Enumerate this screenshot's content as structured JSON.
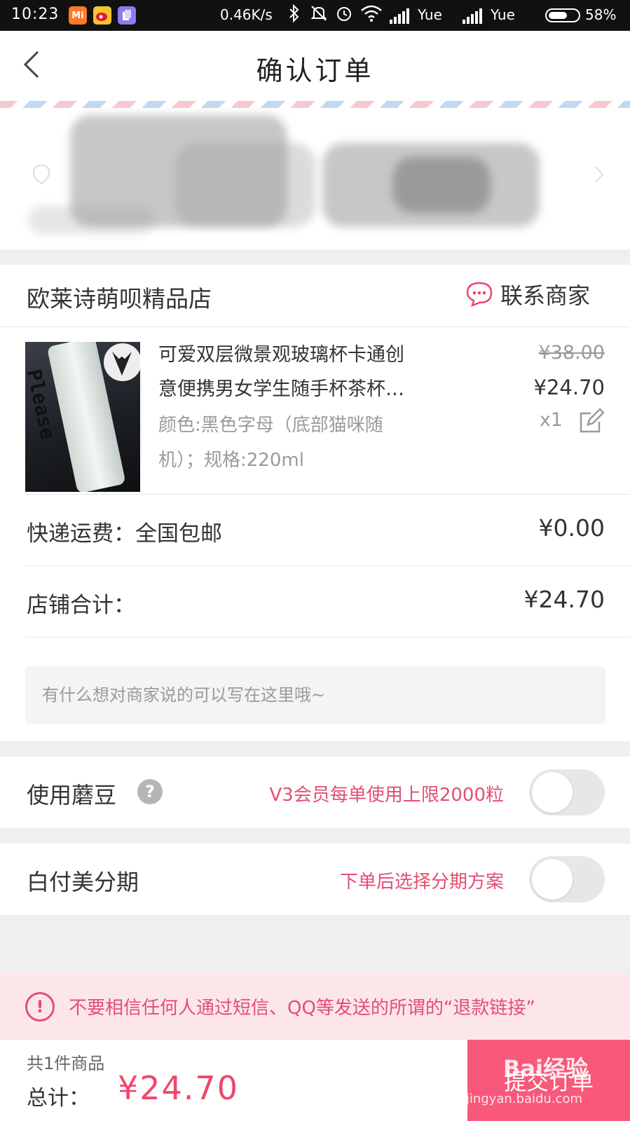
{
  "status_bar": {
    "time": "10:23",
    "net_speed": "0.46K/s",
    "carrier1": "Yue",
    "carrier2": "Yue",
    "battery": "58%",
    "app_icons": [
      "mi-app",
      "weibo",
      "app"
    ]
  },
  "header": {
    "title": "确认订单"
  },
  "shop": {
    "name": "欧莱诗萌呗精品店",
    "contact_label": "联系商家"
  },
  "product": {
    "name_line1": "可爱双层微景观玻璃杯卡通创",
    "name_line2": "意便携男女学生随手杯茶杯…",
    "spec_line1": "颜色:黑色字母（底部猫咪随",
    "spec_line2": "机）；规格:220ml",
    "original_price": "¥38.00",
    "price": "¥24.70",
    "quantity": "x1",
    "image_text": "Please"
  },
  "shipping": {
    "label": "快递运费：全国包邮",
    "value": "¥0.00"
  },
  "shop_total": {
    "label": "店铺合计：",
    "value": "¥24.70"
  },
  "note": {
    "placeholder": "有什么想对商家说的可以写在这里哦~"
  },
  "mushroom_beans": {
    "label": "使用蘑豆",
    "hint": "V3会员每单使用上限2000粒",
    "enabled": false
  },
  "installment": {
    "label": "白付美分期",
    "hint": "下单后选择分期方案",
    "enabled": false
  },
  "notice": {
    "text": "不要相信任何人通过短信、QQ等发送的所谓的“退款链接”"
  },
  "bottom_bar": {
    "count": "共1件商品",
    "total_label": "总计：",
    "total_value": "¥24.70",
    "submit_label": "提交订单"
  },
  "watermark": {
    "logo": "Bai经验",
    "url": "jingyan.baidu.com"
  },
  "colors": {
    "accent": "#f8587a",
    "hint": "#e24f73",
    "notice_bg": "#fde6ea"
  }
}
